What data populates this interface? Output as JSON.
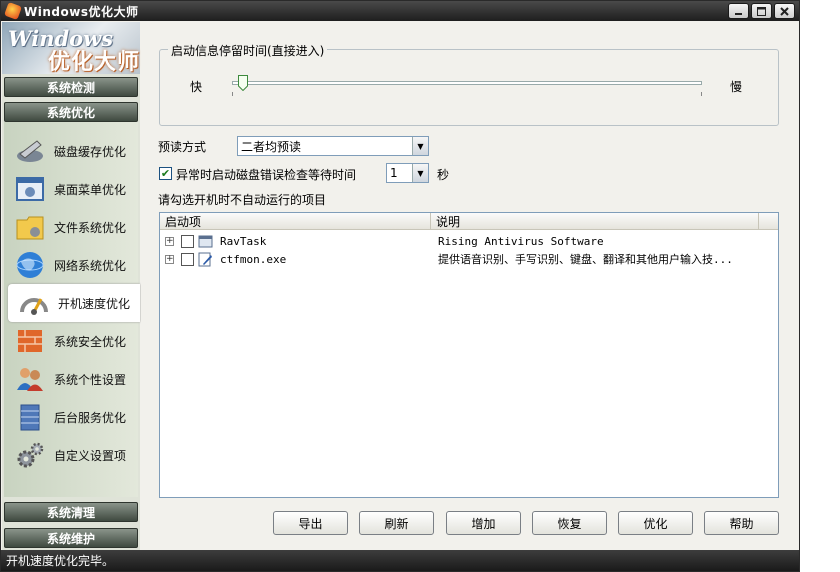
{
  "window": {
    "title": "Windows优化大师"
  },
  "logo": {
    "line1": "Windows",
    "line2": "优化大师"
  },
  "sidebar": {
    "header_detect": "系统检测",
    "header_optimize": "系统优化",
    "items": [
      {
        "label": "磁盘缓存优化",
        "icon": "disk-cache-icon"
      },
      {
        "label": "桌面菜单优化",
        "icon": "desktop-menu-icon"
      },
      {
        "label": "文件系统优化",
        "icon": "file-system-icon"
      },
      {
        "label": "网络系统优化",
        "icon": "network-globe-icon"
      },
      {
        "label": "开机速度优化",
        "icon": "boot-speed-icon"
      },
      {
        "label": "系统安全优化",
        "icon": "firewall-icon"
      },
      {
        "label": "系统个性设置",
        "icon": "users-icon"
      },
      {
        "label": "后台服务优化",
        "icon": "server-icon"
      },
      {
        "label": "自定义设置项",
        "icon": "gears-icon"
      }
    ],
    "footer_clean": "系统清理",
    "footer_maintain": "系统维护"
  },
  "startup_wait": {
    "group_title": "启动信息停留时间(直接进入)",
    "fast_label": "快",
    "slow_label": "慢",
    "value_fraction": 0.0
  },
  "prefetch": {
    "label": "预读方式",
    "value": "二者均预读"
  },
  "disk_check": {
    "checked": true,
    "label": "异常时启动磁盘错误检查等待时间",
    "value": "1",
    "unit": "秒"
  },
  "list_caption": "请勾选开机时不自动运行的项目",
  "startup_list": {
    "columns": [
      "启动项",
      "说明"
    ],
    "rows": [
      {
        "name": "RavTask",
        "desc": "Rising Antivirus Software",
        "checked": false
      },
      {
        "name": "ctfmon.exe",
        "desc": "提供语音识别、手写识别、键盘、翻译和其他用户输入技...",
        "checked": false
      }
    ]
  },
  "buttons": {
    "export": "导出",
    "refresh": "刷新",
    "add": "增加",
    "restore": "恢复",
    "optimize": "优化",
    "help": "帮助"
  },
  "status": {
    "text": "开机速度优化完毕。"
  },
  "colors": {
    "accent": "#3f4a40",
    "title_bar": "#1e1e1e",
    "panel": "#f2f1ec"
  }
}
